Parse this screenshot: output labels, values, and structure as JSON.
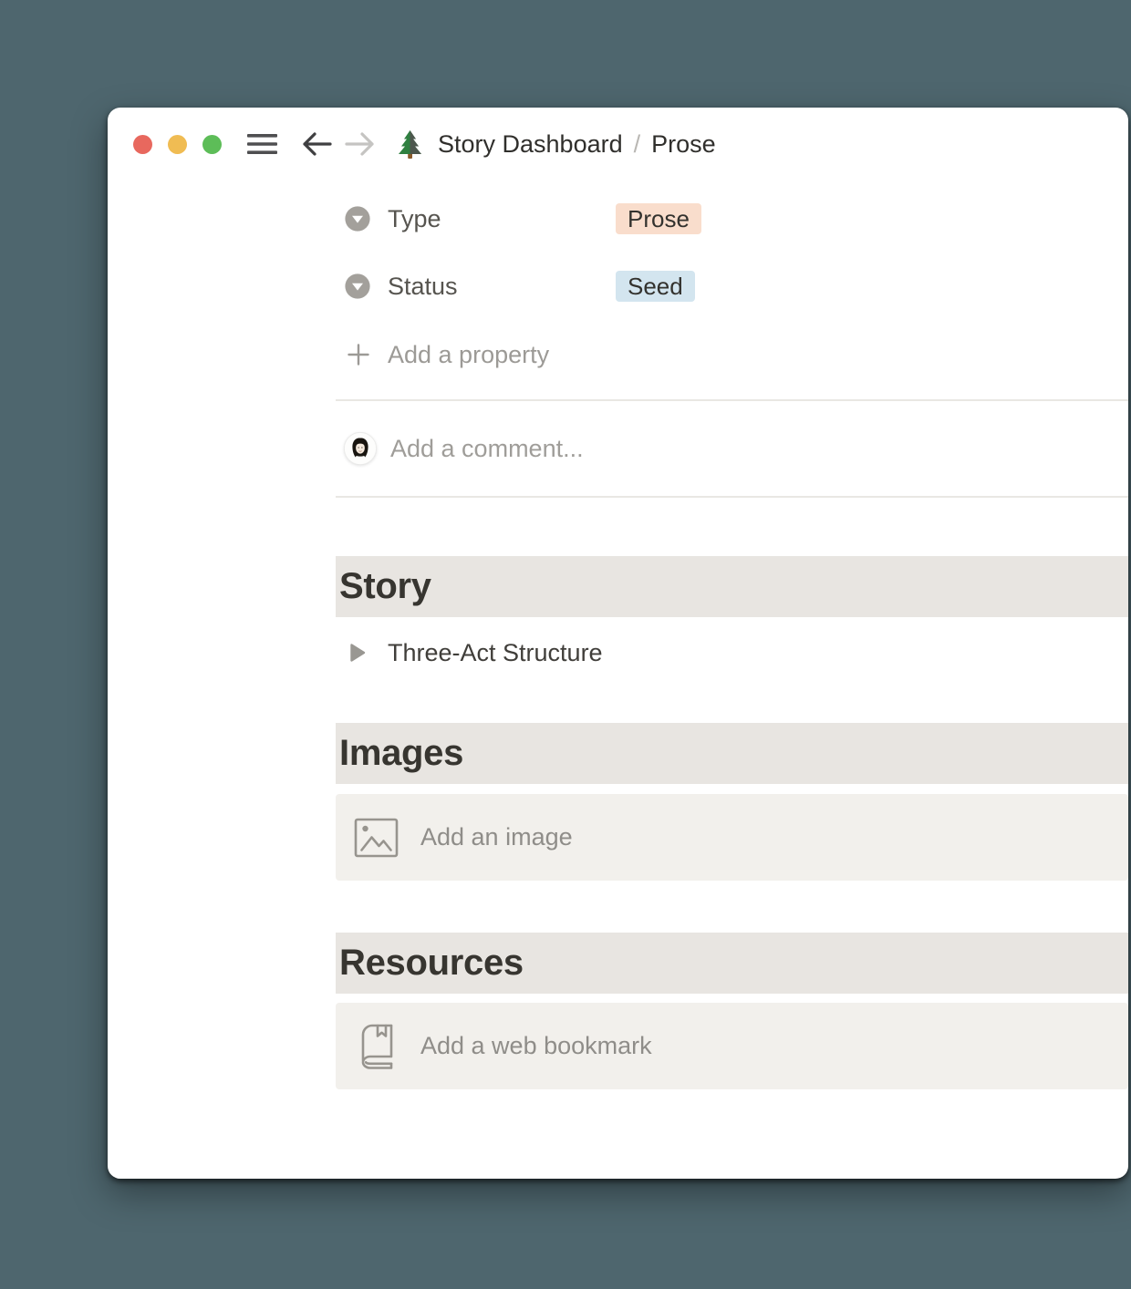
{
  "titlebar": {
    "page_icon": "evergreen-tree",
    "breadcrumb": {
      "root": "Story Dashboard",
      "separator": "/",
      "current": "Prose"
    }
  },
  "properties": {
    "rows": [
      {
        "label": "Type",
        "value": "Prose",
        "value_bg": "#f9ddcc"
      },
      {
        "label": "Status",
        "value": "Seed",
        "value_bg": "#d3e5ef"
      }
    ],
    "add_label": "Add a property"
  },
  "comment": {
    "placeholder": "Add a comment..."
  },
  "sections": [
    {
      "heading": "Story",
      "item": {
        "label": "Three-Act Structure"
      }
    },
    {
      "heading": "Images",
      "item": {
        "label": "Add an image"
      }
    },
    {
      "heading": "Resources",
      "item": {
        "label": "Add a web bookmark"
      }
    }
  ],
  "colors": {
    "desktop_bg": "#4e666e",
    "traffic_red": "#e8685e",
    "traffic_yellow": "#f0bc53",
    "traffic_green": "#5dbd58",
    "heading_band_bg": "#e8e5e1",
    "placeholder_bg": "#f2f0ec"
  }
}
